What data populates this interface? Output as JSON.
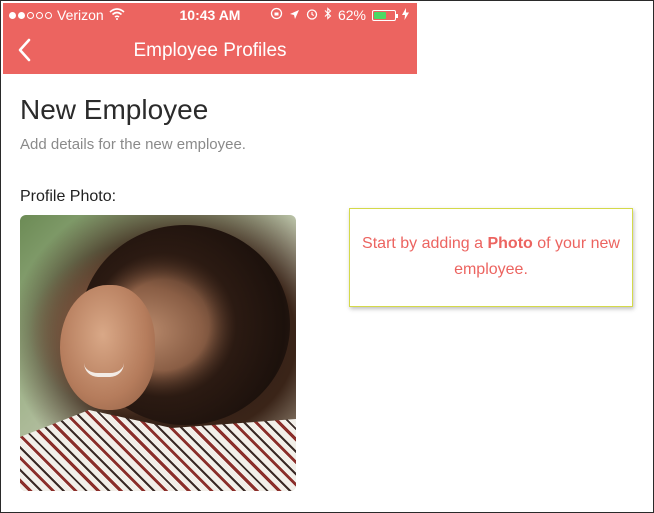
{
  "status_bar": {
    "carrier": "Verizon",
    "time": "10:43 AM",
    "battery_text": "62%",
    "battery_level": 0.62,
    "signal_filled": 2,
    "signal_total": 5
  },
  "nav": {
    "title": "Employee Profiles",
    "back_icon": "chevron-left-icon"
  },
  "page": {
    "title": "New Employee",
    "subtitle": "Add details for the new employee."
  },
  "photo_section": {
    "label": "Profile Photo:"
  },
  "tooltip": {
    "prefix": "Start by adding a ",
    "emphasis": "Photo",
    "suffix": " of your new employee."
  },
  "colors": {
    "header_bg": "#ec6460",
    "tooltip_text": "#ec6460",
    "tooltip_border": "#d4d94a",
    "battery_fill": "#4cd964"
  }
}
